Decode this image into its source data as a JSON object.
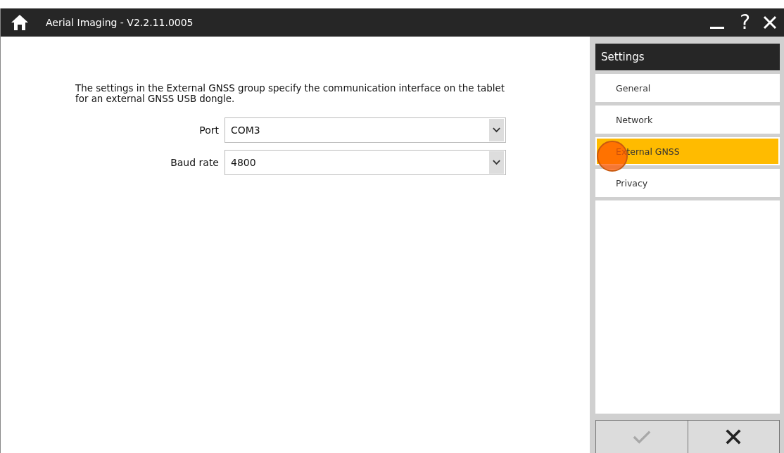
{
  "window": {
    "title": "Aerial Imaging - V2.2.11.0005",
    "help": "?"
  },
  "description": "The settings in the External GNSS group specify the communication interface on the tablet for an external GNSS USB dongle.",
  "fields": [
    {
      "label": "Port",
      "value": "COM3"
    },
    {
      "label": "Baud rate",
      "value": "4800"
    }
  ],
  "sidebar": {
    "title": "Settings",
    "items": [
      {
        "label": "General",
        "selected": false
      },
      {
        "label": "Network",
        "selected": false
      },
      {
        "label": "External GNSS",
        "selected": true
      },
      {
        "label": "Privacy",
        "selected": false
      }
    ]
  },
  "actions": {
    "confirm": {
      "disabled": true
    },
    "cancel": {
      "disabled": false
    }
  }
}
